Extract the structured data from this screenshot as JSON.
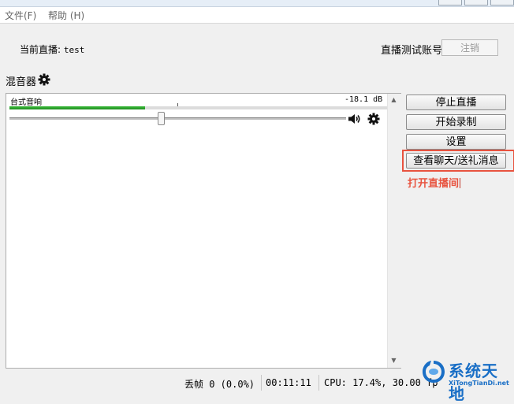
{
  "menu": {
    "file": "文件(F)",
    "help": "帮助 (H)"
  },
  "header": {
    "current_label": "当前直播:",
    "current_value": "test",
    "test_account_label": "直播测试账号",
    "logout_button": "注销"
  },
  "mixer": {
    "title": "混音器",
    "source": {
      "name": "台式音响",
      "db": "-18.1 dB",
      "level": 0.36,
      "volume": 0.45
    }
  },
  "buttons": {
    "stop_stream": "停止直播",
    "start_record": "开始录制",
    "settings": "设置",
    "view_chat": "查看聊天/送礼消息"
  },
  "annotation": "打开直播间",
  "status": {
    "dropped": "丢帧 0 (0.0%)",
    "time": "00:11:11",
    "cpu": "CPU: 17.4%, 30.00 fp"
  },
  "watermark": {
    "title": "系统天地",
    "sub": "XiTongTianDi.net"
  },
  "colors": {
    "accent_red": "#e8533f",
    "meter_green": "#2ea82e",
    "watermark_blue": "#1a6fc6"
  }
}
